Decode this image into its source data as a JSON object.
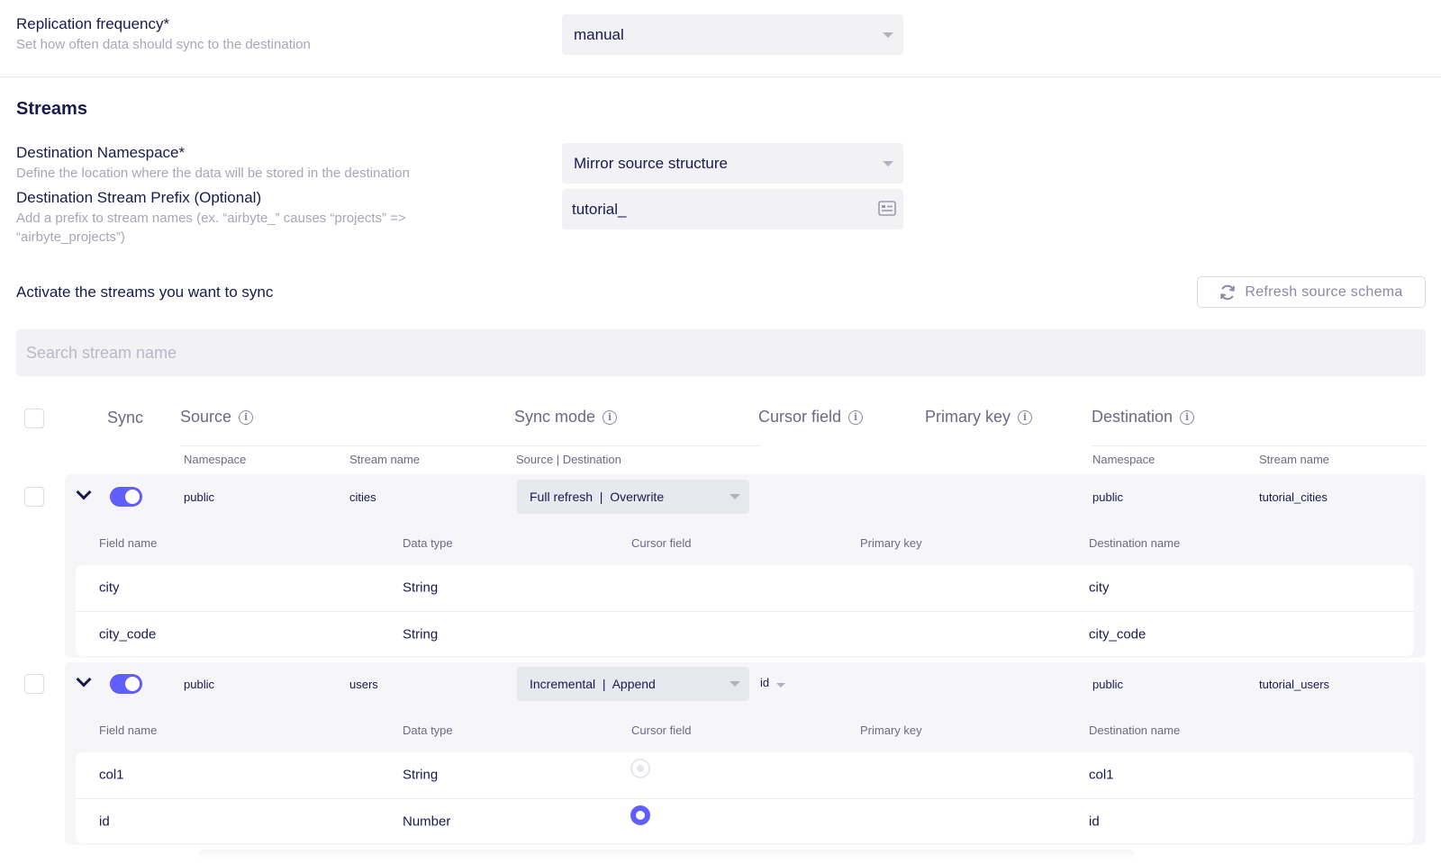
{
  "replication": {
    "label": "Replication frequency*",
    "description": "Set how often data should sync to the destination",
    "value": "manual"
  },
  "streams_section": {
    "title": "Streams",
    "namespace_label": "Destination Namespace*",
    "namespace_description": "Define the location where the data will be stored in the destination",
    "namespace_value": "Mirror source structure",
    "prefix_label": "Destination Stream Prefix (Optional)",
    "prefix_description": "Add a prefix to stream names (ex. “airbyte_” causes “projects” => “airbyte_projects”)",
    "prefix_value": "tutorial_",
    "activate_label": "Activate the streams you want to sync",
    "refresh_label": "Refresh source schema",
    "search_placeholder": "Search stream name"
  },
  "table": {
    "headers": {
      "sync": "Sync",
      "source": "Source",
      "sync_mode": "Sync mode",
      "cursor_field": "Cursor field",
      "primary_key": "Primary key",
      "destination": "Destination"
    },
    "subheaders": {
      "namespace": "Namespace",
      "stream_name": "Stream name",
      "source_destination": "Source | Destination",
      "dest_namespace": "Namespace",
      "dest_stream_name": "Stream name"
    },
    "field_headers": {
      "field_name": "Field name",
      "data_type": "Data type",
      "cursor_field": "Cursor field",
      "primary_key": "Primary key",
      "destination_name": "Destination name"
    },
    "streams": [
      {
        "namespace": "public",
        "stream_name": "cities",
        "sync_mode": "Full refresh  |  Overwrite",
        "cursor": "",
        "dest_namespace": "public",
        "dest_stream_name": "tutorial_cities",
        "enabled": true,
        "fields": [
          {
            "name": "city",
            "type": "String",
            "dest": "city"
          },
          {
            "name": "city_code",
            "type": "String",
            "dest": "city_code"
          }
        ]
      },
      {
        "namespace": "public",
        "stream_name": "users",
        "sync_mode": "Incremental  |  Append",
        "cursor": "id",
        "dest_namespace": "public",
        "dest_stream_name": "tutorial_users",
        "enabled": true,
        "fields": [
          {
            "name": "col1",
            "type": "String",
            "dest": "col1",
            "cursor_selected": false
          },
          {
            "name": "id",
            "type": "Number",
            "dest": "id",
            "cursor_selected": true
          }
        ]
      }
    ]
  },
  "icons": {
    "refresh": "refresh-icon",
    "info": "info-icon",
    "chevron": "chevron-down-icon",
    "caret": "caret-down-icon",
    "prefix_field": "text-field-icon"
  },
  "colors": {
    "accent": "#615eff",
    "text": "#1a194d",
    "muted": "#a7a6b8"
  }
}
